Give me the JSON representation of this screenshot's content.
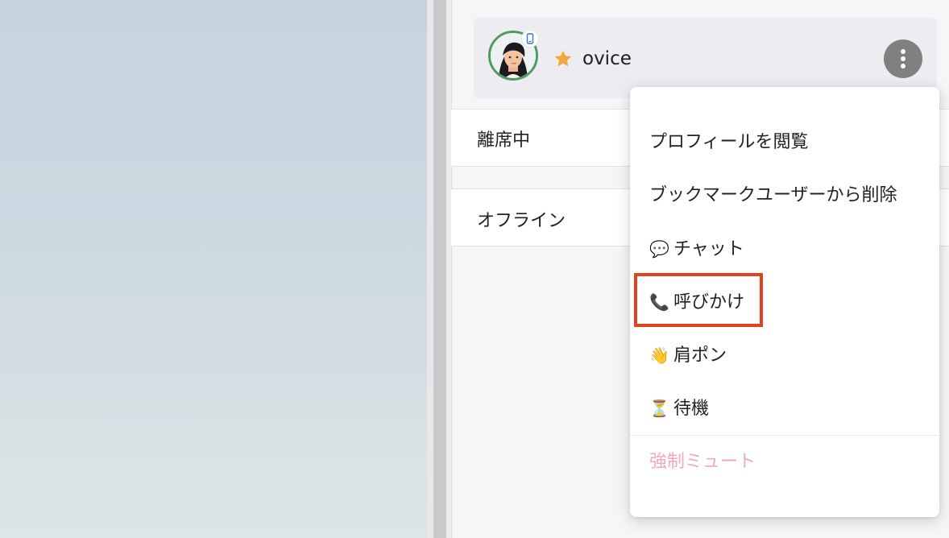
{
  "user": {
    "name": "ovice",
    "bookmarked": true,
    "status_ring_color": "#4c9b61",
    "device_badge": "mobile-phone-icon"
  },
  "sections": [
    {
      "label": "離席中"
    },
    {
      "label": "オフライン"
    }
  ],
  "context_menu": {
    "items": [
      {
        "icon": "",
        "label": "プロフィールを閲覧"
      },
      {
        "icon": "",
        "label": "ブックマークユーザーから削除"
      },
      {
        "icon": "💬",
        "label": "チャット"
      },
      {
        "icon": "📞",
        "label": "呼びかけ"
      },
      {
        "icon": "👋",
        "label": "肩ポン"
      },
      {
        "icon": "⏳",
        "label": "待機"
      }
    ],
    "danger_item": {
      "label": "強制ミュート"
    }
  },
  "colors": {
    "highlight": "#e2431f",
    "danger_text": "#f2a7be",
    "star": "#f0a93a",
    "more_button": "#808080"
  }
}
